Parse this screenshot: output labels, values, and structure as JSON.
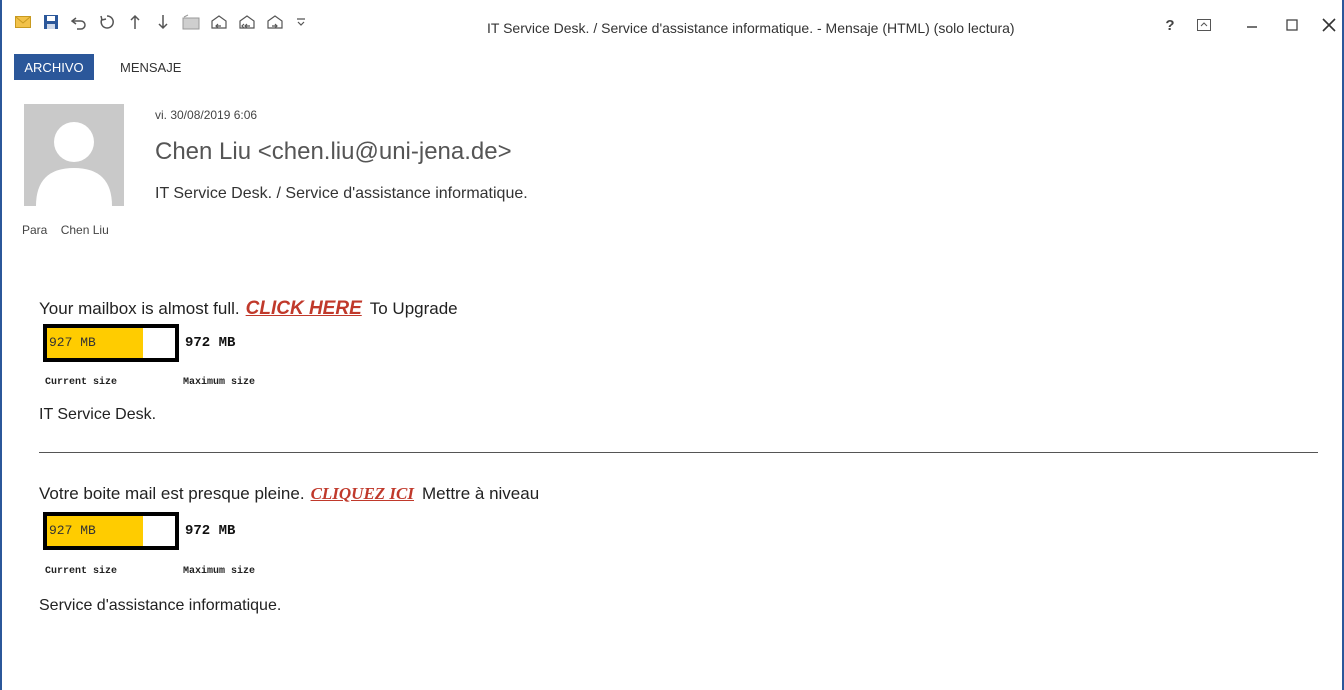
{
  "window": {
    "title": "IT Service Desk. / Service d'assistance informatique. - Mensaje (HTML) (solo lectura)",
    "controls": [
      "help-icon",
      "ribbon-display-icon",
      "minimize-icon",
      "maximize-icon",
      "close-icon"
    ]
  },
  "quick_access": [
    "envelope-icon",
    "save-icon",
    "undo-icon",
    "redo-icon",
    "up-arrow-icon",
    "down-arrow-icon",
    "folder-icon",
    "reply-icon",
    "reply-all-icon",
    "forward-icon",
    "customize-icon"
  ],
  "ribbon": {
    "tabs": [
      "ARCHIVO",
      "MENSAJE"
    ],
    "active_color": "#2b579a"
  },
  "message": {
    "date": "vi. 30/08/2019 6:06",
    "from": "Chen Liu <chen.liu@uni-jena.de>",
    "subject": "IT Service Desk. / Service d'assistance informatique.",
    "to_label": "Para",
    "to_name": "Chen Liu"
  },
  "body": {
    "en": {
      "lead": "Your mailbox is almost full.",
      "link": "CLICK HERE",
      "tail": "To Upgrade",
      "current": "927 MB",
      "maximum": "972 MB",
      "fill_fraction": 0.75,
      "current_label": "Current size",
      "max_label": "Maximum size",
      "signature": "IT Service Desk."
    },
    "fr": {
      "lead": "Votre boite mail est presque pleine.",
      "link": "CLIQUEZ ICI",
      "tail": "Mettre à niveau",
      "current": "927 MB",
      "maximum": "972 MB",
      "fill_fraction": 0.75,
      "current_label": "Current size",
      "max_label": "Maximum size",
      "signature": "Service d'assistance informatique."
    },
    "link_color": "#c0392b",
    "bar_color": "#ffcc00"
  }
}
